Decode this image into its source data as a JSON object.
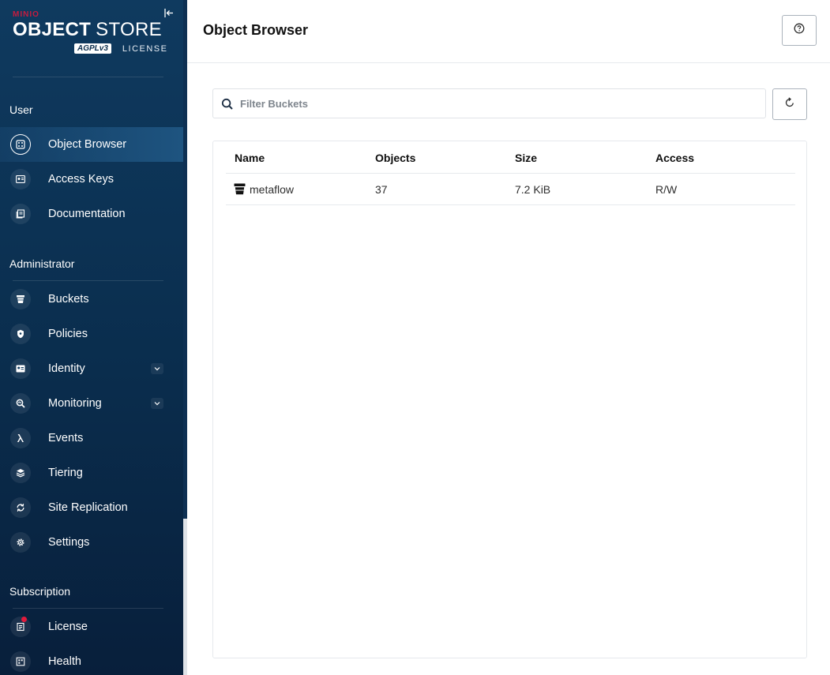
{
  "brand": {
    "minio": "MINIO",
    "product_bold": "OBJECT",
    "product_light": "STORE",
    "license_mark": "AGPLv3",
    "license_text": "LICENSE"
  },
  "sidebar": {
    "sections": [
      {
        "title": "User"
      },
      {
        "title": "Administrator"
      },
      {
        "title": "Subscription"
      }
    ],
    "user_items": [
      {
        "label": "Object Browser",
        "icon": "object-browser-icon",
        "active": true
      },
      {
        "label": "Access Keys",
        "icon": "access-keys-icon"
      },
      {
        "label": "Documentation",
        "icon": "documentation-icon"
      }
    ],
    "admin_items": [
      {
        "label": "Buckets",
        "icon": "bucket-icon"
      },
      {
        "label": "Policies",
        "icon": "policies-icon"
      },
      {
        "label": "Identity",
        "icon": "identity-icon",
        "expandable": true
      },
      {
        "label": "Monitoring",
        "icon": "monitoring-icon",
        "expandable": true
      },
      {
        "label": "Events",
        "icon": "lambda-icon"
      },
      {
        "label": "Tiering",
        "icon": "tiering-icon"
      },
      {
        "label": "Site Replication",
        "icon": "site-replication-icon"
      },
      {
        "label": "Settings",
        "icon": "gear-icon"
      }
    ],
    "subscription_items": [
      {
        "label": "License",
        "icon": "license-icon",
        "notification": true
      },
      {
        "label": "Health",
        "icon": "health-icon"
      }
    ]
  },
  "header": {
    "title": "Object Browser",
    "help_icon": "help-icon"
  },
  "search": {
    "placeholder": "Filter Buckets",
    "value": ""
  },
  "table": {
    "columns": [
      "Name",
      "Objects",
      "Size",
      "Access"
    ],
    "rows": [
      {
        "name": "metaflow",
        "objects": "37",
        "size": "7.2 KiB",
        "access": "R/W"
      }
    ]
  },
  "colors": {
    "sidebar_top": "#0f3a5f",
    "sidebar_bottom": "#081f3b",
    "brand_red": "#c51c3f",
    "notification_red": "#e01b3c"
  }
}
